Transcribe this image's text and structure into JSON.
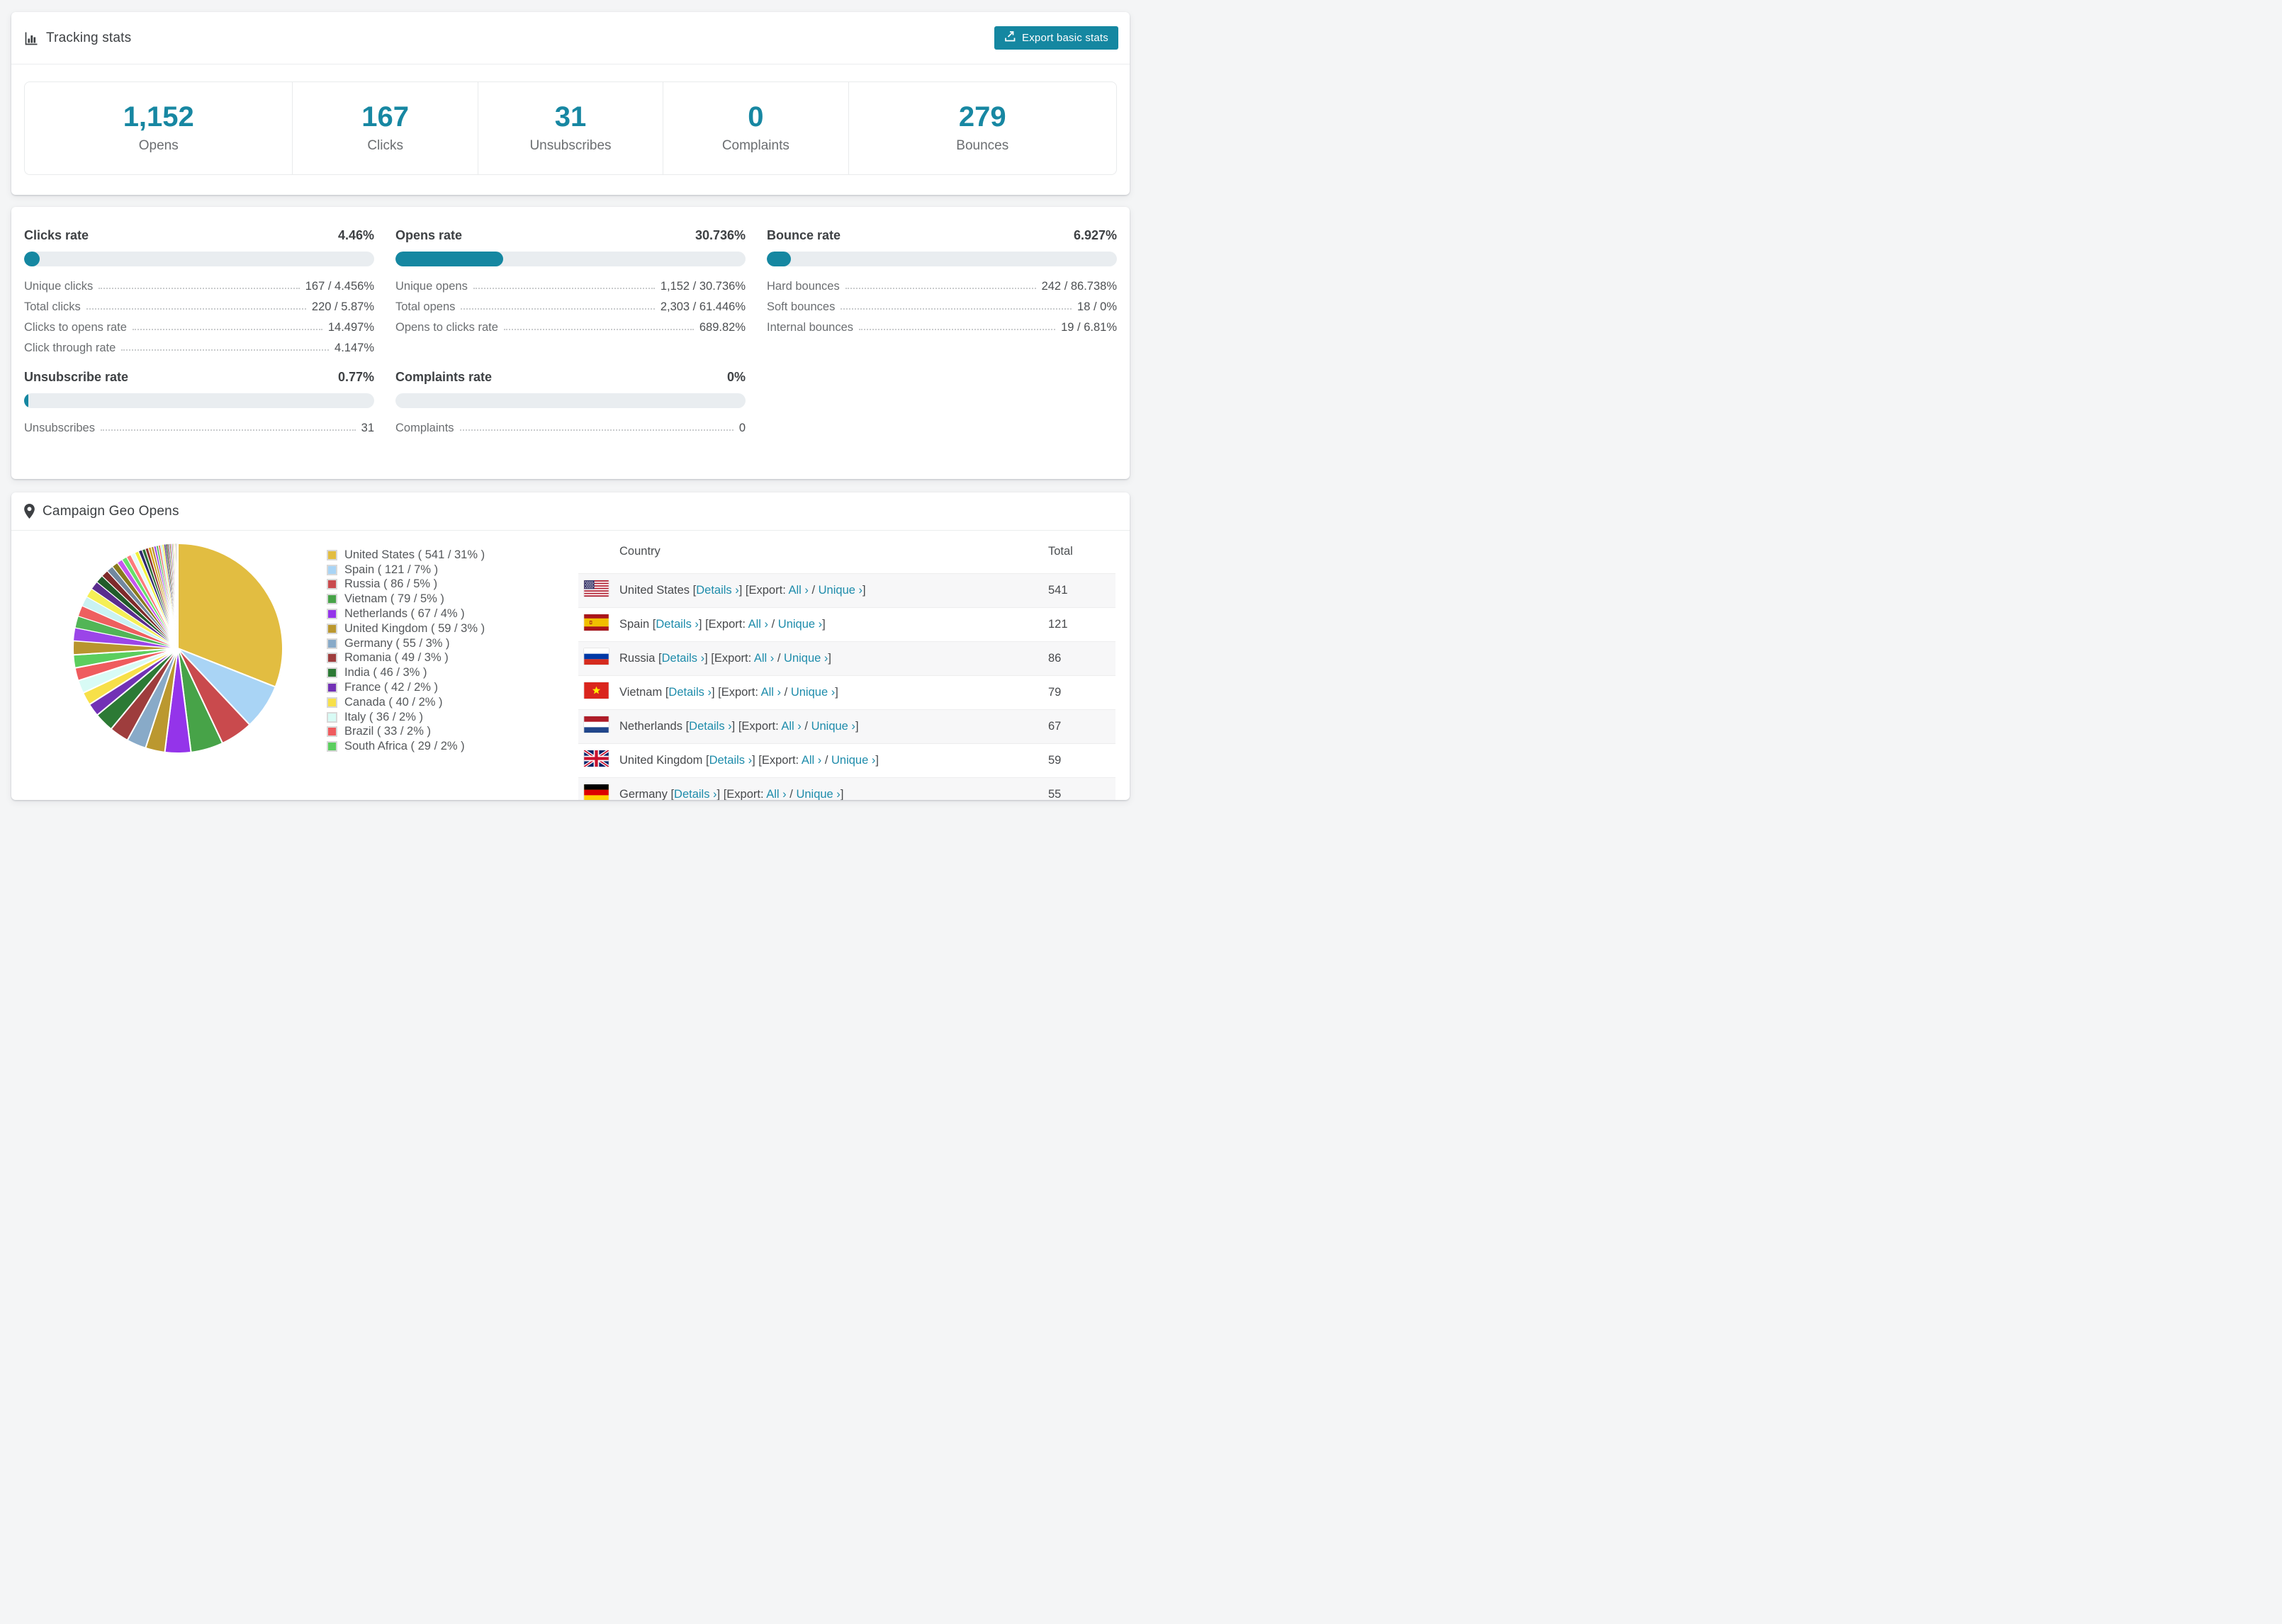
{
  "colors": {
    "accent_teal": "#1587a1",
    "stat_number_teal": "#1787a2",
    "link_teal": "#1e8cab",
    "page_background": "#f4f5f6",
    "row_stripe": "#f7f7f8",
    "bar_track": "#e9edf0"
  },
  "tracking_card": {
    "title": "Tracking stats",
    "export_button": "Export basic stats",
    "stats": [
      {
        "value": "1,152",
        "label": "Opens"
      },
      {
        "value": "167",
        "label": "Clicks"
      },
      {
        "value": "31",
        "label": "Unsubscribes"
      },
      {
        "value": "0",
        "label": "Complaints"
      },
      {
        "value": "279",
        "label": "Bounces"
      }
    ]
  },
  "rates_card": {
    "panels": [
      {
        "title": "Clicks rate",
        "pct": "4.46%",
        "bar_pct": 4.46,
        "rows": [
          {
            "label": "Unique clicks",
            "value": "167 / 4.456%"
          },
          {
            "label": "Total clicks",
            "value": "220 / 5.87%"
          },
          {
            "label": "Clicks to opens rate",
            "value": "14.497%"
          },
          {
            "label": "Click through rate",
            "value": "4.147%"
          }
        ]
      },
      {
        "title": "Opens rate",
        "pct": "30.736%",
        "bar_pct": 30.736,
        "rows": [
          {
            "label": "Unique opens",
            "value": "1,152 / 30.736%"
          },
          {
            "label": "Total opens",
            "value": "2,303 / 61.446%"
          },
          {
            "label": "Opens to clicks rate",
            "value": "689.82%"
          }
        ]
      },
      {
        "title": "Bounce rate",
        "pct": "6.927%",
        "bar_pct": 6.927,
        "rows": [
          {
            "label": "Hard bounces",
            "value": "242 / 86.738%"
          },
          {
            "label": "Soft bounces",
            "value": "18 / 0%"
          },
          {
            "label": "Internal bounces",
            "value": "19 / 6.81%"
          }
        ]
      },
      {
        "title": "Unsubscribe rate",
        "pct": "0.77%",
        "bar_pct": 0.77,
        "rows": [
          {
            "label": "Unsubscribes",
            "value": "31"
          }
        ]
      },
      {
        "title": "Complaints rate",
        "pct": "0%",
        "bar_pct": 0,
        "rows": [
          {
            "label": "Complaints",
            "value": "0"
          }
        ]
      }
    ]
  },
  "geo_card": {
    "title": "Campaign Geo Opens",
    "table": {
      "headers": [
        "Country",
        "Total"
      ],
      "link_labels": {
        "details": "Details",
        "export": "Export:",
        "all": "All",
        "unique": "Unique",
        "arrow": "›",
        "open": "[",
        "close": "]",
        "slash": "/"
      },
      "rows": [
        {
          "key": "united-states",
          "country": "United States",
          "flag": "us",
          "total": "541"
        },
        {
          "key": "spain",
          "country": "Spain",
          "flag": "es",
          "total": "121"
        },
        {
          "key": "russia",
          "country": "Russia",
          "flag": "ru",
          "total": "86"
        },
        {
          "key": "vietnam",
          "country": "Vietnam",
          "flag": "vn",
          "total": "79"
        },
        {
          "key": "netherlands",
          "country": "Netherlands",
          "flag": "nl",
          "total": "67"
        },
        {
          "key": "united-kingdom",
          "country": "United Kingdom",
          "flag": "gb",
          "total": "59"
        },
        {
          "key": "germany",
          "country": "Germany",
          "flag": "de",
          "total": "55"
        }
      ]
    }
  },
  "chart_data": {
    "type": "pie",
    "title": "Campaign Geo Opens",
    "unit": "opens",
    "legend_position": "right",
    "series": [
      {
        "key": "united-states",
        "name": "United States",
        "value": 541,
        "pct": 31,
        "color": "#e2bd41"
      },
      {
        "key": "spain",
        "name": "Spain",
        "value": 121,
        "pct": 7,
        "color": "#a9d4f5"
      },
      {
        "key": "russia",
        "name": "Russia",
        "value": 86,
        "pct": 5,
        "color": "#c94a4d"
      },
      {
        "key": "vietnam",
        "name": "Vietnam",
        "value": 79,
        "pct": 5,
        "color": "#47a348"
      },
      {
        "key": "netherlands",
        "name": "Netherlands",
        "value": 67,
        "pct": 4,
        "color": "#9434ea"
      },
      {
        "key": "united-kingdom",
        "name": "United Kingdom",
        "value": 59,
        "pct": 3,
        "color": "#bb982f"
      },
      {
        "key": "germany",
        "name": "Germany",
        "value": 55,
        "pct": 3,
        "color": "#88aac8"
      },
      {
        "key": "romania",
        "name": "Romania",
        "value": 49,
        "pct": 3,
        "color": "#9e3d3d"
      },
      {
        "key": "india",
        "name": "India",
        "value": 46,
        "pct": 3,
        "color": "#2c7a35"
      },
      {
        "key": "france",
        "name": "France",
        "value": 42,
        "pct": 2,
        "color": "#7231b5"
      },
      {
        "key": "canada",
        "name": "Canada",
        "value": 40,
        "pct": 2,
        "color": "#f7e049"
      },
      {
        "key": "italy",
        "name": "Italy",
        "value": 36,
        "pct": 2,
        "color": "#d8fbf5"
      },
      {
        "key": "brazil",
        "name": "Brazil",
        "value": 33,
        "pct": 2,
        "color": "#ef5b5e"
      },
      {
        "key": "south-africa",
        "name": "South Africa",
        "value": 29,
        "pct": 2,
        "color": "#5bce5e"
      }
    ],
    "legend_label_format": "{name} ( {value} / {pct}% )",
    "others_pct_total": 26,
    "others_note": "remaining opens shown as many unlabeled thin slices"
  }
}
